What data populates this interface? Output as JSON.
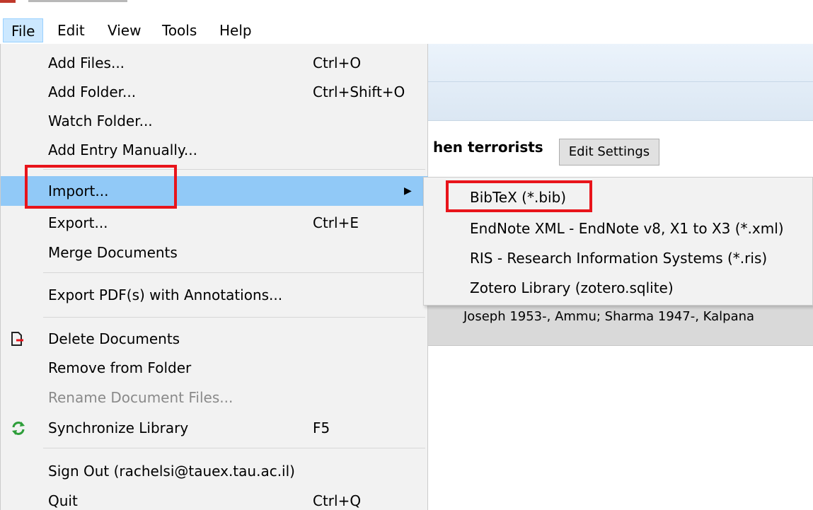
{
  "colors": {
    "menu_bg": "#f2f2f2",
    "highlight": "#91c9f7",
    "annotation_red": "#e8141b",
    "sync_green": "#2e9e3a"
  },
  "menubar": {
    "items": [
      {
        "label": "File"
      },
      {
        "label": "Edit"
      },
      {
        "label": "View"
      },
      {
        "label": "Tools"
      },
      {
        "label": "Help"
      }
    ]
  },
  "background": {
    "title_fragment": "hen terrorists",
    "edit_settings_label": "Edit Settings",
    "authors": "Joseph  1953-, Ammu; Sharma  1947-, Kalpana"
  },
  "file_menu": {
    "add_files": {
      "label": "Add Files...",
      "shortcut": "Ctrl+O"
    },
    "add_folder": {
      "label": "Add Folder...",
      "shortcut": "Ctrl+Shift+O"
    },
    "watch_folder": {
      "label": "Watch Folder..."
    },
    "add_entry": {
      "label": "Add Entry Manually..."
    },
    "import": {
      "label": "Import...",
      "arrow": "▶"
    },
    "export": {
      "label": "Export...",
      "shortcut": "Ctrl+E"
    },
    "merge": {
      "label": "Merge Documents"
    },
    "export_pdf": {
      "label": "Export PDF(s) with Annotations..."
    },
    "delete_docs": {
      "label": "Delete Documents",
      "icon": "delete-document-icon"
    },
    "remove_folder": {
      "label": "Remove from Folder"
    },
    "rename_files": {
      "label": "Rename Document Files..."
    },
    "sync": {
      "label": "Synchronize Library",
      "shortcut": "F5",
      "icon": "sync-icon"
    },
    "sign_out": {
      "label": "Sign Out (rachelsi@tauex.tau.ac.il)"
    },
    "quit": {
      "label": "Quit",
      "shortcut": "Ctrl+Q"
    }
  },
  "import_submenu": {
    "items": [
      {
        "label": "BibTeX (*.bib)"
      },
      {
        "label": "EndNote XML - EndNote v8, X1 to X3 (*.xml)"
      },
      {
        "label": "RIS - Research Information Systems (*.ris)"
      },
      {
        "label": "Zotero Library (zotero.sqlite)"
      }
    ]
  }
}
